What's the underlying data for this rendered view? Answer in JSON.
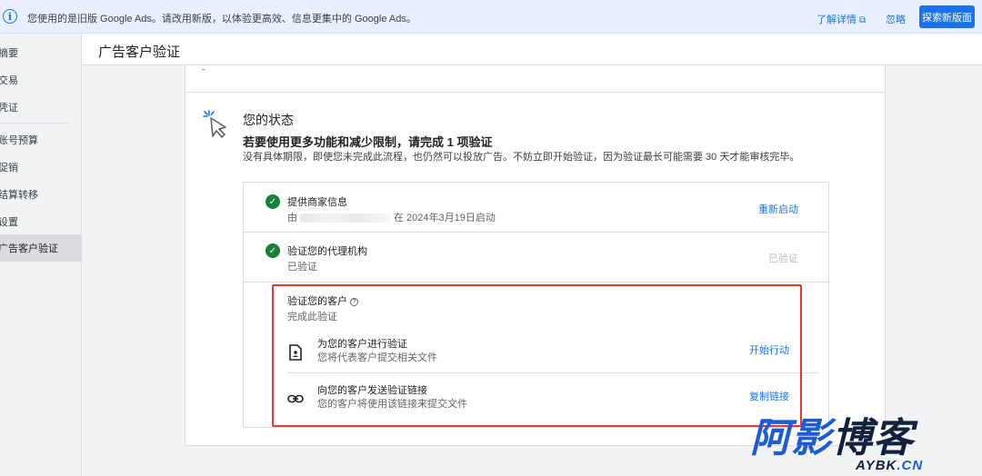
{
  "banner": {
    "message": "您使用的是旧版 Google Ads。请改用新版，以体验更高效、信息更集中的 Google Ads。",
    "learn_more": "了解详情",
    "ignore": "忽略",
    "explore_button": "探索新版面"
  },
  "sidebar": {
    "items": [
      {
        "label": "摘要"
      },
      {
        "label": "交易"
      },
      {
        "label": "凭证"
      },
      {
        "label": "账号预算"
      },
      {
        "label": "促销"
      },
      {
        "label": "结算转移"
      },
      {
        "label": "设置"
      },
      {
        "label": "广告客户验证"
      }
    ]
  },
  "header": {
    "title": "广告客户验证"
  },
  "status": {
    "title": "您的状态",
    "headline": "若要使用更多功能和减少限制，请完成 1 项验证",
    "description": "没有具体期限，即使您未完成此流程，也仍然可以投放广告。不妨立即开始验证，因为验证最长可能需要 30 天才能审核完毕。"
  },
  "steps": [
    {
      "title": "提供商家信息",
      "subtitle_prefix": "由",
      "subtitle_suffix": "在 2024年3月19日启动",
      "action": "重新启动"
    },
    {
      "title": "验证您的代理机构",
      "subtitle": "已验证",
      "action": "已验证"
    },
    {
      "title": "验证您的客户",
      "subtitle": "完成此验证",
      "options": [
        {
          "icon": "document-person-icon",
          "title": "为您的客户进行验证",
          "description": "您将代表客户提交相关文件",
          "action": "开始行动"
        },
        {
          "icon": "link-icon",
          "title": "向您的客户发送验证链接",
          "description": "您的客户将使用该链接来提交文件",
          "action": "复制链接"
        }
      ]
    }
  ],
  "watermark": {
    "main_blue": "阿影",
    "main_dark": "博客",
    "sub_dark": "AYBK",
    "sub_blue": ".CN"
  },
  "colors": {
    "accent": "#1a73e8",
    "success": "#188038",
    "highlight": "#e53935"
  }
}
